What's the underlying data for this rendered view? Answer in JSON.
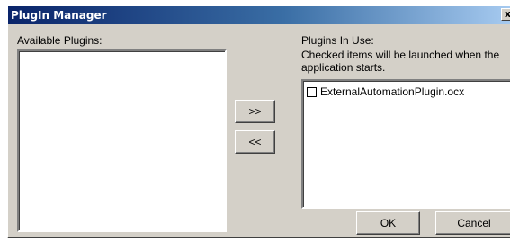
{
  "window": {
    "title": "PlugIn Manager",
    "close_label": "x"
  },
  "available": {
    "label": "Available Plugins:",
    "items": []
  },
  "in_use": {
    "label": "Plugins In Use:",
    "note": "Checked items will be launched when the application starts.",
    "items": [
      {
        "label": "ExternalAutomationPlugin.ocx",
        "checked": false
      }
    ]
  },
  "buttons": {
    "add": ">>",
    "remove": "<<",
    "ok": "OK",
    "cancel": "Cancel"
  }
}
